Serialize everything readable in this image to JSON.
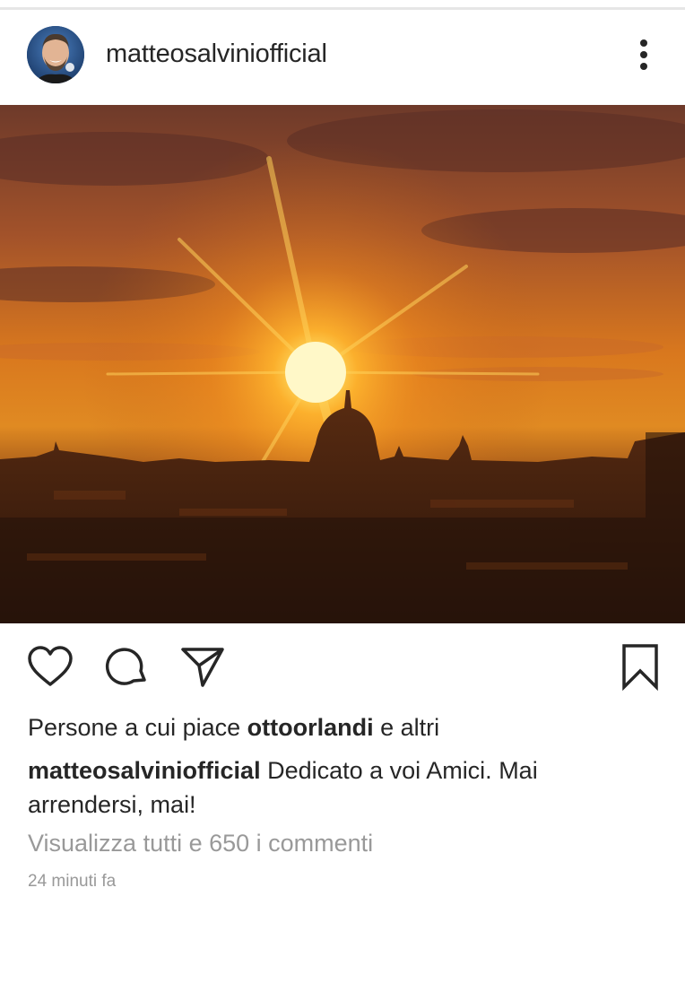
{
  "post": {
    "username": "matteosalviniofficial",
    "avatar_icon": "profile-avatar",
    "menu_icon": "more-vertical-icon"
  },
  "photo": {
    "description_icon": "sunset-photo"
  },
  "actions": {
    "like_icon": "heart-icon",
    "comment_icon": "comment-icon",
    "share_icon": "send-icon",
    "save_icon": "bookmark-icon"
  },
  "likes": {
    "prefix": "Persone a cui piace ",
    "user": "ottoorlandi",
    "suffix": " e altri"
  },
  "caption": {
    "username": "matteosalviniofficial",
    "text": " Dedicato a voi Amici. Mai arrendersi, mai!"
  },
  "comments": {
    "label": "Visualizza tutti e 650 i commenti"
  },
  "time": {
    "label": "24 minuti fa"
  },
  "colors": {
    "text": "#262626",
    "muted": "#999999",
    "sky_top": "#8a4a2c",
    "sun": "#fff3a0"
  }
}
